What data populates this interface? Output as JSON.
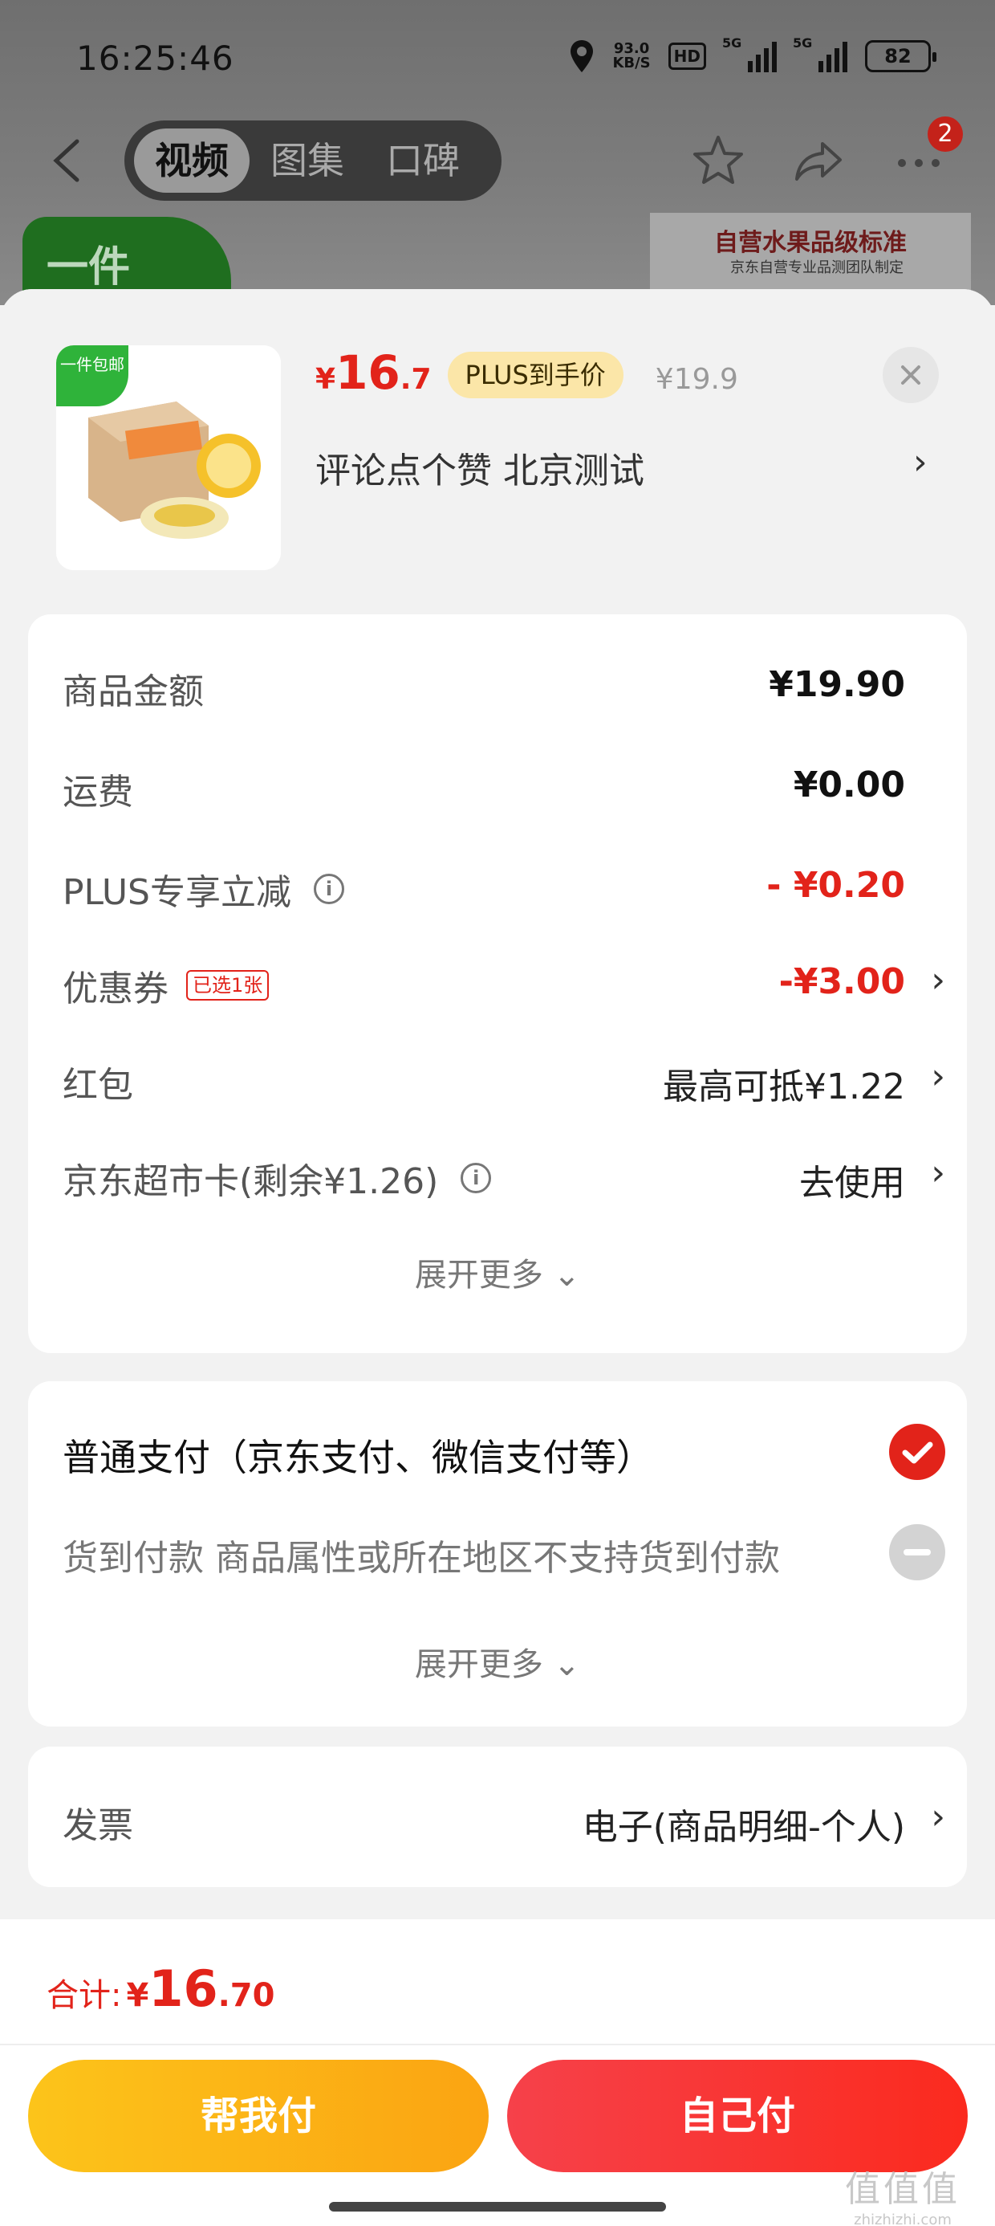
{
  "status_bar": {
    "time": "16:25:46",
    "speed_value": "93.0",
    "speed_unit": "KB/S",
    "hd_label": "HD",
    "net1": "5G",
    "net2": "5G",
    "battery": "82"
  },
  "nav": {
    "tabs": [
      {
        "label": "视频",
        "active": true
      },
      {
        "label": "图集",
        "active": false
      },
      {
        "label": "口碑",
        "active": false
      }
    ],
    "badge_count": "2"
  },
  "background_promo": {
    "left_text": "一件",
    "right_title": "自营水果品级标准",
    "right_subtitle": "京东自营专业品测团队制定"
  },
  "product": {
    "thumb_tag": "一件包邮",
    "price_symbol": "¥",
    "price_int": "16",
    "price_dec": ".7",
    "plus_label": "PLUS到手价",
    "original_price": "¥19.9",
    "name": "评论点个赞  北京测试",
    "close_icon": "close-icon"
  },
  "summary": {
    "rows": [
      {
        "label": "商品金额",
        "value": "¥19.90"
      },
      {
        "label": "运费",
        "value": "¥0.00"
      },
      {
        "label": "PLUS专享立减",
        "value": "- ¥0.20"
      },
      {
        "label": "优惠券",
        "tag": "已选1张",
        "value": "-¥3.00"
      },
      {
        "label": "红包",
        "value": "最高可抵¥1.22"
      },
      {
        "label": "京东超市卡(剩余¥1.26)",
        "value": "去使用"
      }
    ],
    "expand_label": "展开更多"
  },
  "payment": {
    "options": [
      {
        "label": "普通支付（京东支付、微信支付等）",
        "selected": true
      },
      {
        "label": "货到付款  商品属性或所在地区不支持货到付款",
        "selected": false
      }
    ],
    "expand_label": "展开更多"
  },
  "invoice": {
    "label": "发票",
    "value": "电子(商品明细-个人)"
  },
  "footer": {
    "total_label": "合计:",
    "total_symbol": "¥",
    "total_int": "16",
    "total_dec": ".70",
    "help_pay_label": "帮我付",
    "self_pay_label": "自己付"
  },
  "watermark": {
    "line1": "值值值",
    "line2": "zhizhizhi.com"
  },
  "colors": {
    "accent_red": "#e2231a",
    "help_button_yellow": "#fcc41a",
    "self_button_red": "#f6414a",
    "plus_badge": "#fbe6a8"
  }
}
